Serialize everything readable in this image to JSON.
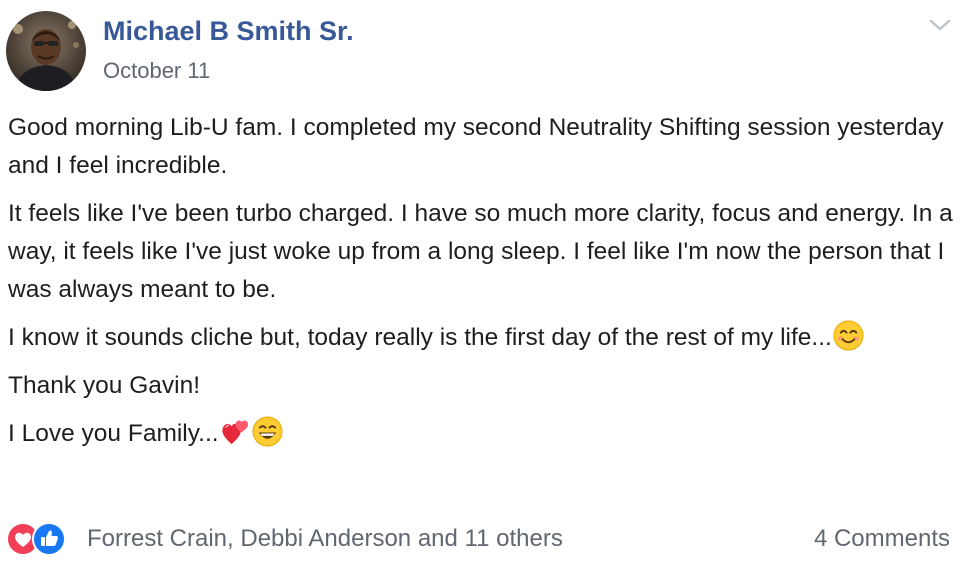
{
  "post": {
    "author_name": "Michael B Smith Sr.",
    "date": "October 11",
    "menu_icon": "chevron-down-icon",
    "paragraphs": [
      {
        "text": "Good morning Lib-U fam. I completed my second Neutrality Shifting session yesterday and I feel incredible.",
        "emoji": []
      },
      {
        "text": "It feels like I've been turbo charged. I have so much more clarity, focus and energy. In a way, it feels like I've just woke up from a long sleep. I feel like I'm now the person that I was always meant to be.",
        "emoji": []
      },
      {
        "text": "I know it sounds cliche but, today really is the first day of the rest of my life...",
        "emoji": [
          "smiling-face-emoji"
        ]
      },
      {
        "text": "Thank you Gavin!",
        "emoji": []
      },
      {
        "text": "I Love you Family...",
        "emoji": [
          "two-hearts-emoji",
          "grinning-face-emoji"
        ]
      }
    ]
  },
  "reactions": {
    "icons": [
      "love-reaction-icon",
      "like-reaction-icon"
    ],
    "names_text": "Forrest Crain, Debbi Anderson and 11 others",
    "comments_text": "4 Comments"
  },
  "colors": {
    "author_link": "#385898",
    "secondary_text": "#606770",
    "body_text": "#1c1e21",
    "love_red": "#f33e58",
    "like_blue": "#1877f2"
  }
}
